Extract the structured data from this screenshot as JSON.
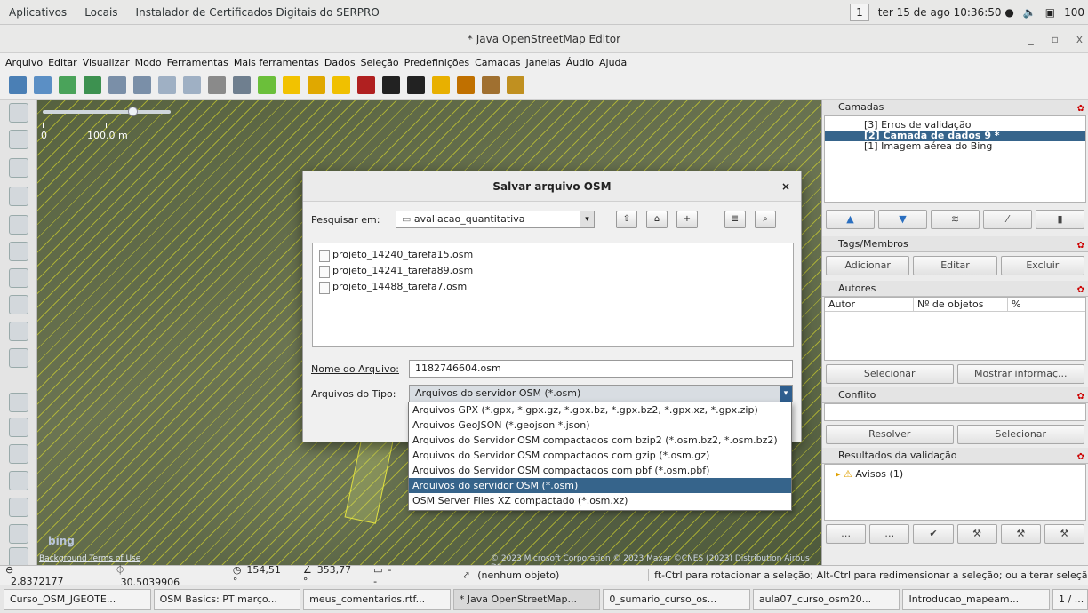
{
  "topbar": {
    "apps": "Aplicativos",
    "places": "Locais",
    "serpro": "Instalador de Certificados Digitais do SERPRO",
    "workspace": "1",
    "datetime": "ter 15 de ago  10:36:50 ●",
    "volume": "100"
  },
  "window": {
    "title": "* Java OpenStreetMap Editor",
    "min": "_",
    "max": "▫",
    "close": "x"
  },
  "menu": [
    "Arquivo",
    "Editar",
    "Visualizar",
    "Modo",
    "Ferramentas",
    "Mais ferramentas",
    "Dados",
    "Seleção",
    "Predefinições",
    "Camadas",
    "Janelas",
    "Áudio",
    "Ajuda"
  ],
  "map": {
    "scale_zero": "0",
    "scale_label": "100.0 m",
    "bing": "bing",
    "bg_terms": "Background Terms of Use",
    "attribution": "© 2023 Microsoft Corporation © 2023 Maxar ©CNES (2023) Distribution Airbus DS"
  },
  "layers": {
    "header": "Camadas",
    "items": [
      {
        "label": "[3]  Erros de validação"
      },
      {
        "label": "[2]  Camada de dados 9 *"
      },
      {
        "label": "[1]  Imagem aérea do Bing"
      }
    ]
  },
  "tags": {
    "header": "Tags/Membros",
    "add": "Adicionar",
    "edit": "Editar",
    "delete": "Excluir"
  },
  "authors": {
    "header": "Autores",
    "col_author": "Autor",
    "col_count": "Nº de objetos",
    "col_pct": "%",
    "select": "Selecionar",
    "show": "Mostrar informaç..."
  },
  "conflict": {
    "header": "Conflito",
    "resolve": "Resolver",
    "select": "Selecionar"
  },
  "validation": {
    "header": "Resultados da validação",
    "warnings": "Avisos (1)"
  },
  "status": {
    "lat": "2.8372177",
    "lon": "30.5039906",
    "heading": "154,51 °",
    "angle": "353,77 °",
    "length": "--",
    "object": "(nenhum objeto)",
    "hint": "ft-Ctrl para rotacionar a seleção; Alt-Ctrl para redimensionar a seleção; ou alterar seleçã"
  },
  "taskbar": [
    "Curso_OSM_JGEOTE...",
    "OSM Basics: PT março...",
    "meus_comentarios.rtf...",
    "* Java OpenStreetMap...",
    "0_sumario_curso_os...",
    "aula07_curso_osm20...",
    "Introducao_mapeam...",
    "1 / ..."
  ],
  "dialog": {
    "title": "Salvar arquivo OSM",
    "close": "×",
    "lookin_label": "Pesquisar em:",
    "lookin_value": "avaliacao_quantitativa",
    "files": [
      "projeto_14240_tarefa15.osm",
      "projeto_14241_tarefa89.osm",
      "projeto_14488_tarefa7.osm"
    ],
    "filename_label": "Nome do Arquivo:",
    "filename_value": "1182746604.osm",
    "filetype_label": "Arquivos do Tipo:",
    "filetype_value": "Arquivos do servidor OSM (*.osm)",
    "options": [
      "Arquivos GPX (*.gpx, *.gpx.gz, *.gpx.bz, *.gpx.bz2, *.gpx.xz, *.gpx.zip)",
      "Arquivos GeoJSON (*.geojson *.json)",
      "Arquivos do Servidor OSM compactados com bzip2 (*.osm.bz2, *.osm.bz2)",
      "Arquivos do Servidor OSM compactados com gzip (*.osm.gz)",
      "Arquivos do Servidor OSM compactados com pbf (*.osm.pbf)",
      "Arquivos do servidor OSM (*.osm)",
      "OSM Server Files XZ compactado (*.osm.xz)"
    ]
  },
  "colors": {
    "selection": "#36648b",
    "accent_red": "#cc0000"
  }
}
